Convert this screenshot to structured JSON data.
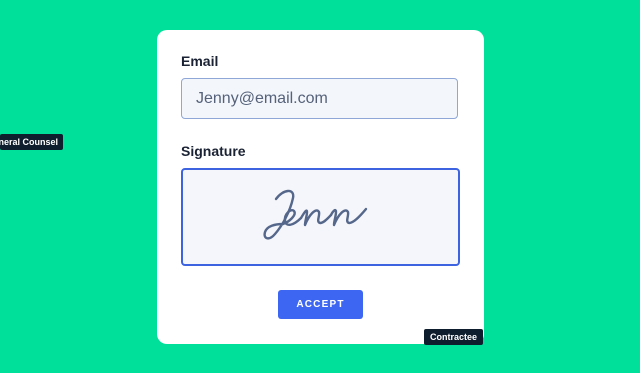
{
  "form": {
    "email_label": "Email",
    "email_value": "Jenny@email.com",
    "signature_label": "Signature",
    "signature_text": "Jenn",
    "accept_label": "ACCEPT"
  },
  "tags": {
    "general_counsel": "General Counsel",
    "contractee": "Contractee"
  },
  "colors": {
    "background": "#00E09A",
    "card": "#FFFFFF",
    "accent": "#3D66F2",
    "signature_ink": "#55678A",
    "tag_bg": "#0F1E2E"
  }
}
